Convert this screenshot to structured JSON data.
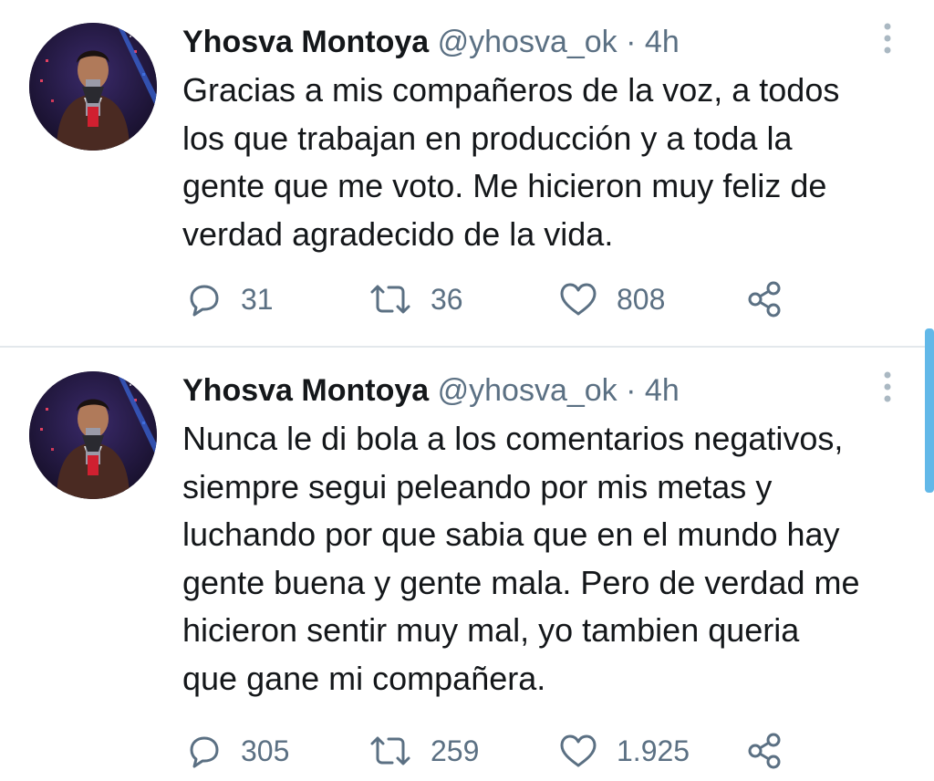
{
  "tweets": [
    {
      "author_name": "Yhosva Montoya",
      "handle": "@yhosva_ok",
      "separator": "·",
      "time": "4h",
      "text_lines": [
        "Gracias a mis compañeros de la voz, a todos",
        "los que trabajan en producción y a toda la",
        "gente que me voto. Me hicieron muy feliz de",
        "verdad agradecido de la vida."
      ],
      "replies": "31",
      "retweets": "36",
      "likes": "808",
      "icons": {
        "reply": "reply-bubble-icon",
        "retweet": "retweet-icon",
        "like": "heart-icon",
        "share": "share-icon",
        "more": "more-vertical-icon"
      }
    },
    {
      "author_name": "Yhosva Montoya",
      "handle": "@yhosva_ok",
      "separator": "·",
      "time": "4h",
      "text_lines": [
        "Nunca le di bola a los comentarios negativos,",
        "siempre segui peleando por mis metas y",
        "luchando por que sabia que en el mundo hay",
        "gente buena y gente mala. Pero de verdad me",
        "hicieron sentir muy mal, yo tambien queria",
        "que gane mi compañera."
      ],
      "replies": "305",
      "retweets": "259",
      "likes": "1.925",
      "icons": {
        "reply": "reply-bubble-icon",
        "retweet": "retweet-icon",
        "like": "heart-icon",
        "share": "share-icon",
        "more": "more-vertical-icon"
      }
    }
  ],
  "colors": {
    "text": "#14171a",
    "secondary": "#5b7083",
    "divider": "#e3e8ec",
    "scrollbar": "#62b8e8"
  }
}
